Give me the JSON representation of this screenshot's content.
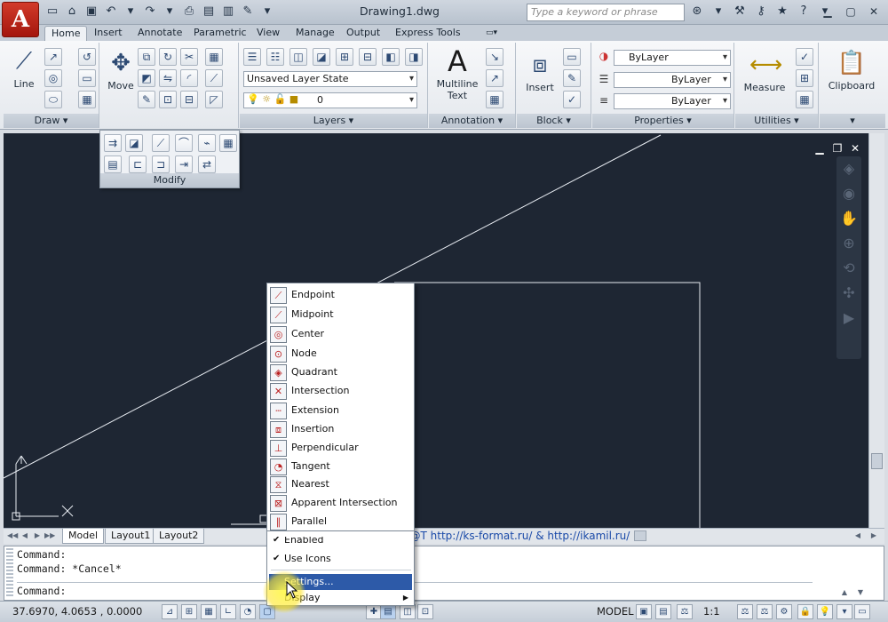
{
  "app": {
    "logo_letter": "A",
    "title": "Drawing1.dwg"
  },
  "search": {
    "placeholder": "Type a keyword or phrase"
  },
  "tabs": [
    "Home",
    "Insert",
    "Annotate",
    "Parametric",
    "View",
    "Manage",
    "Output",
    "Express Tools"
  ],
  "ribbon": {
    "draw": {
      "title": "Draw",
      "line_label": "Line"
    },
    "modify": {
      "move_label": "Move",
      "flyout_title": "Modify"
    },
    "layers": {
      "title": "Layers",
      "layer_state": "Unsaved Layer State",
      "current_layer": "0"
    },
    "annotation": {
      "title": "Annotation",
      "text_label_1": "Multiline",
      "text_label_2": "Text"
    },
    "block": {
      "title": "Block",
      "insert_label": "Insert"
    },
    "properties": {
      "title": "Properties",
      "color": "ByLayer",
      "linetype": "ByLayer",
      "lineweight": "ByLayer"
    },
    "utilities": {
      "title": "Utilities",
      "measure_label": "Measure"
    },
    "clipboard": {
      "title": "Clipboard"
    }
  },
  "layout_tabs": [
    "Model",
    "Layout1",
    "Layout2"
  ],
  "watermark": "RostArtStudio & ФОРМ@Т http://ks-format.ru/ & http://ikamil.ru/",
  "command": {
    "line1": "Command:",
    "line2": "Command: *Cancel*",
    "prompt": "Command:"
  },
  "status": {
    "coords": "37.6970, 4.0653 , 0.0000",
    "model": "MODEL",
    "scale": "1:1"
  },
  "osnap_menu": {
    "items": [
      {
        "label": "Endpoint",
        "icon": "endpoint-icon"
      },
      {
        "label": "Midpoint",
        "icon": "midpoint-icon"
      },
      {
        "label": "Center",
        "icon": "center-icon"
      },
      {
        "label": "Node",
        "icon": "node-icon"
      },
      {
        "label": "Quadrant",
        "icon": "quadrant-icon"
      },
      {
        "label": "Intersection",
        "icon": "intersection-icon"
      },
      {
        "label": "Extension",
        "icon": "extension-icon"
      },
      {
        "label": "Insertion",
        "icon": "insertion-icon"
      },
      {
        "label": "Perpendicular",
        "icon": "perpendicular-icon"
      },
      {
        "label": "Tangent",
        "icon": "tangent-icon"
      },
      {
        "label": "Nearest",
        "icon": "nearest-icon"
      },
      {
        "label": "Apparent Intersection",
        "icon": "apparent-intersection-icon"
      },
      {
        "label": "Parallel",
        "icon": "parallel-icon"
      }
    ],
    "enabled_label": "Enabled",
    "use_icons_label": "Use Icons",
    "settings_label": "Settings...",
    "display_label": "Display"
  }
}
